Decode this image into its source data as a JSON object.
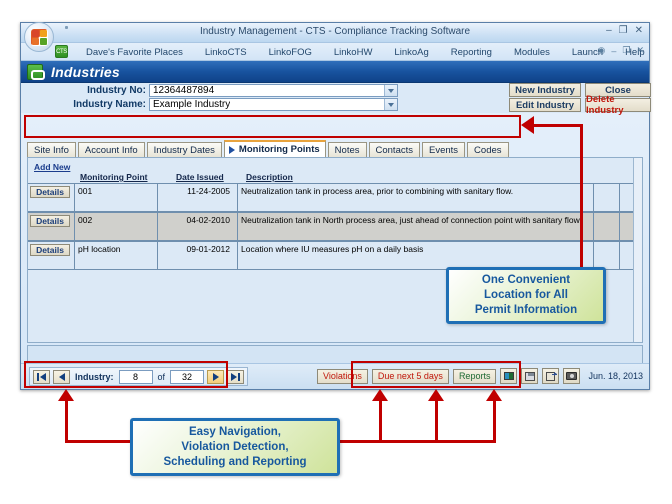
{
  "window": {
    "title": "Industry Management - CTS - Compliance Tracking Software",
    "app_icon": "office-orb-icon",
    "minimize": "–",
    "restore": "❐",
    "close": "✕"
  },
  "menubar": {
    "badge": "CTS",
    "items": [
      {
        "label": "Dave's Favorite Places"
      },
      {
        "label": "LinkoCTS"
      },
      {
        "label": "LinkoFOG"
      },
      {
        "label": "LinkoHW"
      },
      {
        "label": "LinkoAg"
      },
      {
        "label": "Reporting"
      },
      {
        "label": "Modules"
      },
      {
        "label": "Launch"
      },
      {
        "label": "Help"
      }
    ],
    "right_icons": [
      "help-icon",
      "minimize-icon",
      "restore-icon",
      "close-icon"
    ],
    "right_glyphs": [
      "◉",
      "–",
      "❐",
      "✕"
    ]
  },
  "page_header": {
    "title": "Industries",
    "icon": "industries-icon"
  },
  "form": {
    "industry_no_label": "Industry No:",
    "industry_no_value": "12364487894",
    "industry_name_label": "Industry Name:",
    "industry_name_value": "Example Industry"
  },
  "actions": {
    "new_industry": "New Industry",
    "close": "Close",
    "edit_industry": "Edit Industry",
    "delete_industry": "Delete Industry"
  },
  "tabs": [
    {
      "label": "Site Info",
      "active": false
    },
    {
      "label": "Account Info",
      "active": false
    },
    {
      "label": "Industry Dates",
      "active": false
    },
    {
      "label": "Monitoring Points",
      "active": true
    },
    {
      "label": "Notes",
      "active": false
    },
    {
      "label": "Contacts",
      "active": false
    },
    {
      "label": "Events",
      "active": false
    },
    {
      "label": "Codes",
      "active": false
    }
  ],
  "grid": {
    "add_new": "Add New",
    "details_label": "Details",
    "columns": [
      "Monitoring Point",
      "Date Issued",
      "Description"
    ],
    "rows": [
      {
        "monitoring_point": "001",
        "date_issued": "11-24-2005",
        "description": "Neutralization tank in process area, prior to combining with sanitary flow."
      },
      {
        "monitoring_point": "002",
        "date_issued": "04-02-2010",
        "description": "Neutralization tank in North process area, just ahead of connection point with sanitary flow."
      },
      {
        "monitoring_point": "pH location",
        "date_issued": "09-01-2012",
        "description": "Location where IU measures pH on a daily basis"
      }
    ]
  },
  "navigation": {
    "first": "first-record-icon",
    "previous": "previous-record-icon",
    "label": "Industry:",
    "current": "8",
    "of": "of",
    "total": "32",
    "next": "next-record-icon",
    "last": "last-record-icon"
  },
  "toolbar": {
    "violations": "Violations",
    "due_next_5_days": "Due next 5 days",
    "reports": "Reports",
    "icons": [
      "grid-view-icon",
      "save-icon",
      "exit-door-icon",
      "camera-icon"
    ],
    "date": "Jun. 18, 2013"
  },
  "annotations": {
    "callout_top": "One Convenient\nLocation for All\nPermit Information",
    "callout_top_lines": [
      "One Convenient",
      "Location for All",
      "Permit Information"
    ],
    "callout_bottom_lines": [
      "Easy Navigation,",
      "Violation Detection,",
      "Scheduling and Reporting"
    ],
    "accent_color": "#c00000",
    "callout_border_color": "#1f6fb5",
    "callout_text_color": "#17589e"
  }
}
